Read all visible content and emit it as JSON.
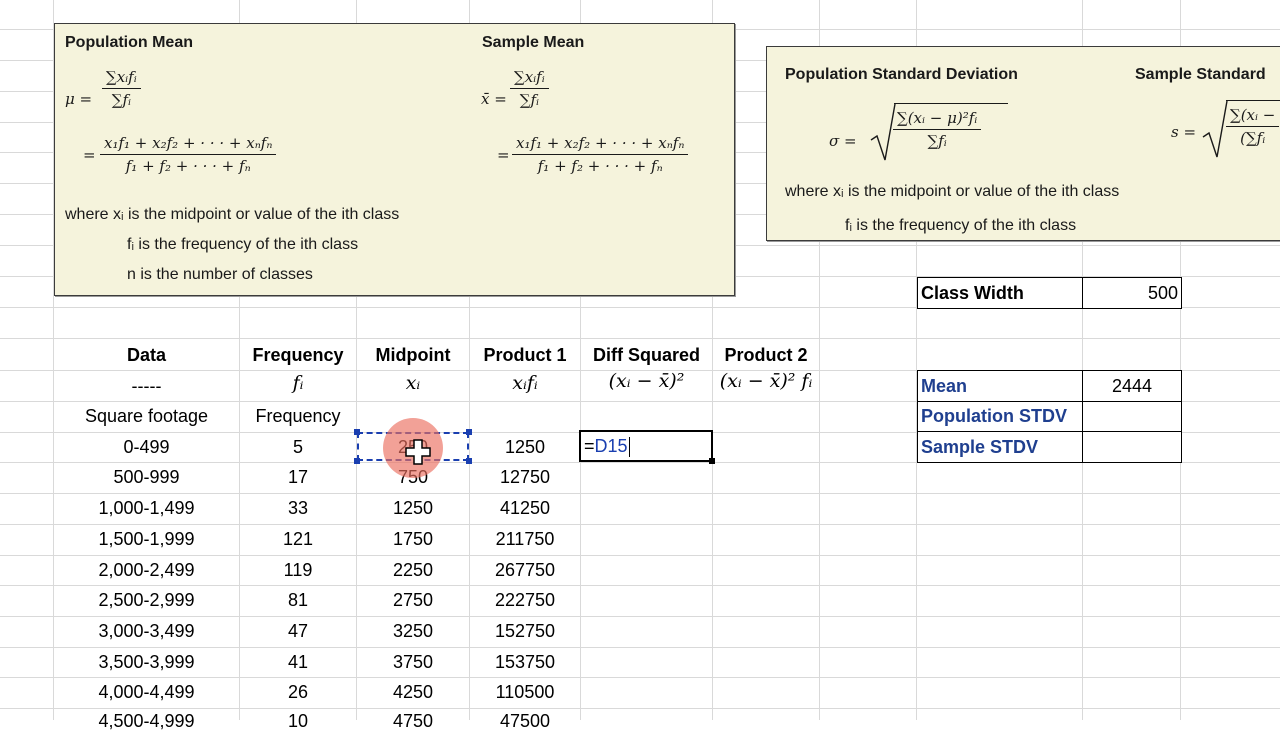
{
  "formula_box_left": {
    "population_mean_title": "Population Mean",
    "sample_mean_title": "Sample Mean",
    "mu": "μ =",
    "xbar": "x̄ =",
    "sum_num": "∑xᵢfᵢ",
    "sum_den": "∑fᵢ",
    "eq": "=",
    "expanded_num": "x₁f₁ + x₂f₂ + · · · + xₙfₙ",
    "expanded_den": "f₁ + f₂ + · · · + fₙ",
    "where_line1": "where xᵢ is the midpoint or value of the ith class",
    "where_line2": "fᵢ is the frequency of the ith class",
    "where_line3": "n is the number of classes"
  },
  "formula_box_right": {
    "pop_std_title": "Population Standard Deviation",
    "sample_std_title": "Sample Standard",
    "sigma_eq": "σ =",
    "s_eq": "s =",
    "pop_num": "∑(xᵢ − μ)²fᵢ",
    "pop_den": "∑fᵢ",
    "samp_num": "∑(xᵢ −",
    "samp_den": "(∑fᵢ",
    "where_line1": "where xᵢ is the midpoint or value of the ith class",
    "where_line2": "fᵢ is the frequency of the ith class"
  },
  "headers": {
    "data": "Data",
    "frequency": "Frequency",
    "midpoint": "Midpoint",
    "product1": "Product 1",
    "diff_squared": "Diff Squared",
    "product2": "Product 2"
  },
  "subheaders": {
    "dashes": "-----",
    "fi": "fᵢ",
    "xi": "xᵢ",
    "xifi": "xᵢfᵢ",
    "diff": "(xᵢ − x̄)²",
    "prod2": "(xᵢ − x̄)² fᵢ"
  },
  "labels": {
    "square_footage": "Square footage",
    "frequency": "Frequency"
  },
  "rows": [
    {
      "data": "0-499",
      "freq": "5",
      "mid": "250",
      "prod": "1250"
    },
    {
      "data": "500-999",
      "freq": "17",
      "mid": "750",
      "prod": "12750"
    },
    {
      "data": "1,000-1,499",
      "freq": "33",
      "mid": "1250",
      "prod": "41250"
    },
    {
      "data": "1,500-1,999",
      "freq": "121",
      "mid": "1750",
      "prod": "211750"
    },
    {
      "data": "2,000-2,499",
      "freq": "119",
      "mid": "2250",
      "prod": "267750"
    },
    {
      "data": "2,500-2,999",
      "freq": "81",
      "mid": "2750",
      "prod": "222750"
    },
    {
      "data": "3,000-3,499",
      "freq": "47",
      "mid": "3250",
      "prod": "152750"
    },
    {
      "data": "3,500-3,999",
      "freq": "41",
      "mid": "3750",
      "prod": "153750"
    },
    {
      "data": "4,000-4,499",
      "freq": "26",
      "mid": "4250",
      "prod": "110500"
    },
    {
      "data": "4,500-4,999",
      "freq": "10",
      "mid": "4750",
      "prod": "47500"
    }
  ],
  "active_cell": {
    "formula_eq": "=",
    "formula_ref": "D15"
  },
  "class_width": {
    "label": "Class Width",
    "value": "500"
  },
  "stats": {
    "mean_label": "Mean",
    "mean_value": "2444",
    "pop_stdv_label": "Population STDV",
    "pop_stdv_value": "",
    "sample_stdv_label": "Sample STDV",
    "sample_stdv_value": ""
  },
  "colors": {
    "formula_box_bg": "#f5f3dc",
    "selection_blue": "#1a3fb0",
    "formula_ref_blue": "#1a3fb0",
    "label_blue": "#1f3f8f",
    "highlight": "#eb6e5f"
  }
}
